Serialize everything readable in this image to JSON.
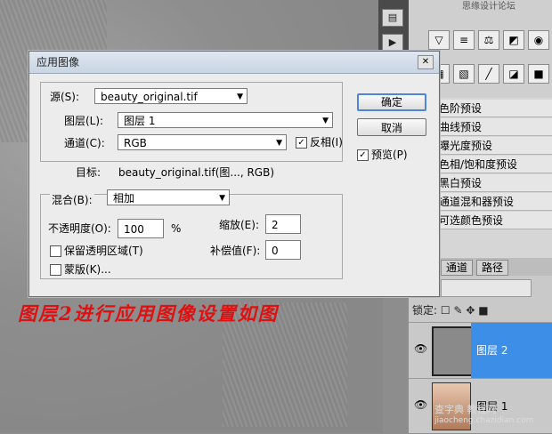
{
  "dialog": {
    "title": "应用图像",
    "source_label": "源(S):",
    "source_value": "beauty_original.tif",
    "layer_label": "图层(L):",
    "layer_value": "图层 1",
    "channel_label": "通道(C):",
    "channel_value": "RGB",
    "invert_label": "反相(I)",
    "invert_checked": true,
    "target_label": "目标:",
    "target_value": "beauty_original.tif(图..., RGB)",
    "blending_label": "混合(B):",
    "blending_value": "相加",
    "opacity_label": "不透明度(O):",
    "opacity_value": "100",
    "opacity_unit": "%",
    "scale_label": "缩放(E):",
    "scale_value": "2",
    "offset_label": "补偿值(F):",
    "offset_value": "0",
    "preserve_label": "保留透明区域(T)",
    "mask_label": "蒙版(K)...",
    "ok_label": "确定",
    "cancel_label": "取消",
    "preview_label": "预览(P)",
    "preview_checked": true
  },
  "caption": "图层2进行应用图像设置如图",
  "adjustments": {
    "presets": [
      "色阶预设",
      "曲线预设",
      "曝光度预设",
      "色相/饱和度预设",
      "黑白预设",
      "通道混和器预设",
      "可选颜色预设"
    ]
  },
  "panel_tabs": [
    "通道",
    "路径"
  ],
  "layers": {
    "lock_label": "锁定:",
    "items": [
      {
        "name": "图层 2",
        "selected": true
      },
      {
        "name": "图层 1",
        "selected": false
      }
    ]
  },
  "header_fragment": "思缘设计论坛",
  "watermark": {
    "line1": "查字典 教程网",
    "line2": "jiaocheng.chazidian.com"
  }
}
